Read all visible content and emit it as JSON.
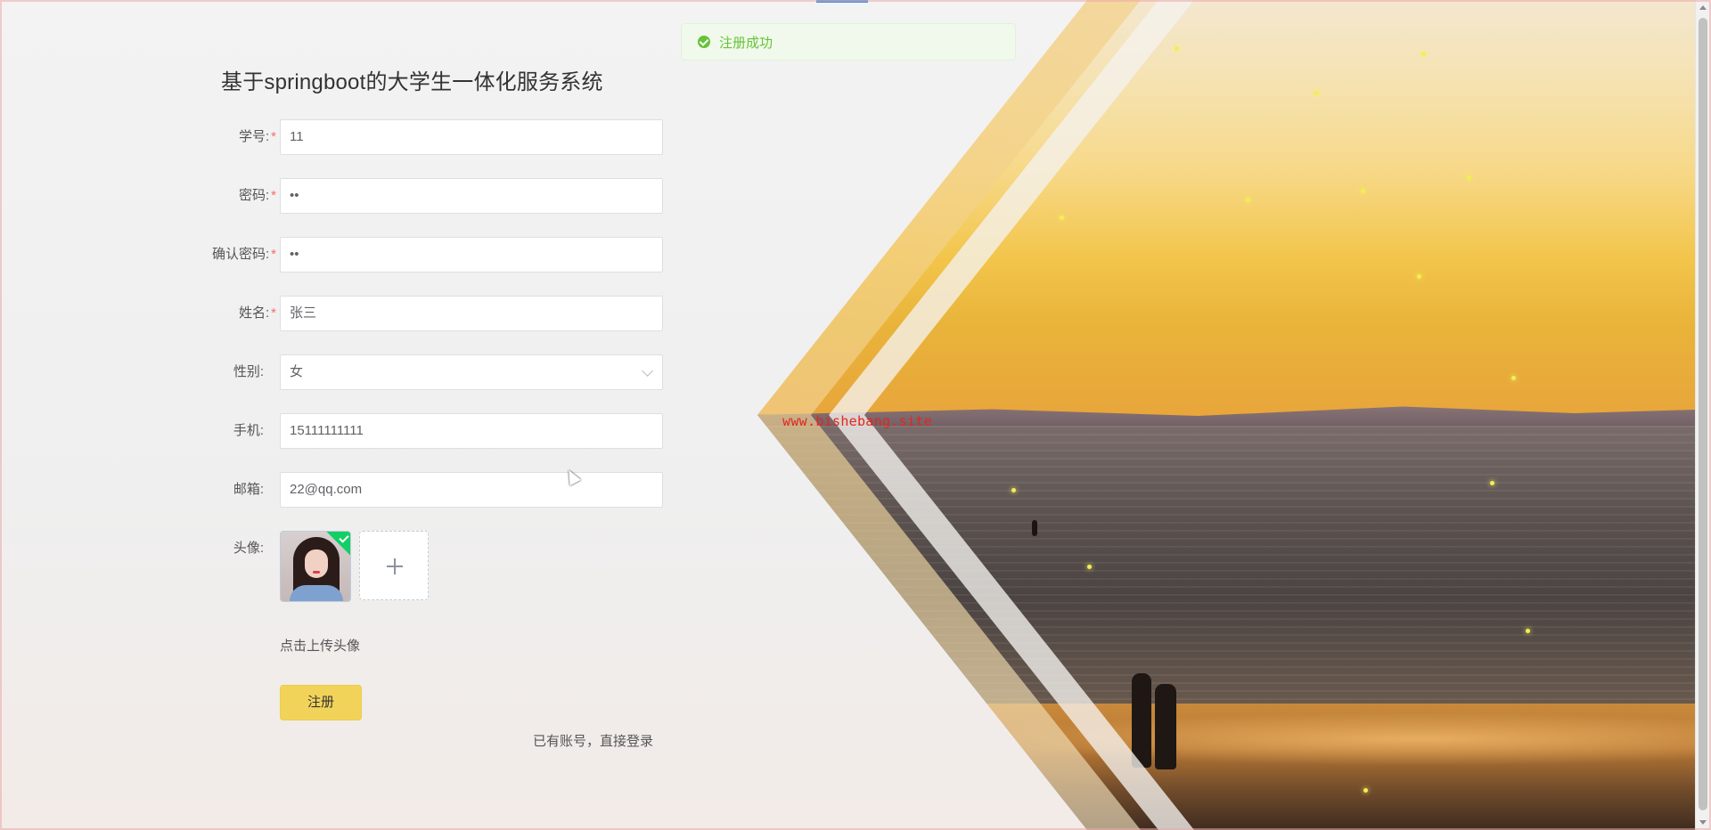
{
  "toast": {
    "message": "注册成功",
    "icon": "check-circle-icon",
    "color": "#67c23a"
  },
  "watermark": "www.bishebang.site",
  "form": {
    "title": "基于springboot的大学生一体化服务系统",
    "fields": {
      "student_id": {
        "label": "学号",
        "value": "11",
        "required": true
      },
      "password": {
        "label": "密码",
        "value": "••",
        "required": true
      },
      "confirm_password": {
        "label": "确认密码",
        "value": "••",
        "required": true
      },
      "name": {
        "label": "姓名",
        "value": "张三",
        "required": true
      },
      "gender": {
        "label": "性别",
        "value": "女",
        "required": false
      },
      "phone": {
        "label": "手机",
        "value": "15111111111",
        "required": false
      },
      "email": {
        "label": "邮箱",
        "value": "22@qq.com",
        "required": false
      },
      "avatar": {
        "label": "头像",
        "required": false
      }
    },
    "colon": ":",
    "required_mark": "*",
    "upload_hint": "点击上传头像",
    "submit_label": "注册",
    "login_link": "已有账号，直接登录",
    "accent_color": "#f2d35a"
  }
}
